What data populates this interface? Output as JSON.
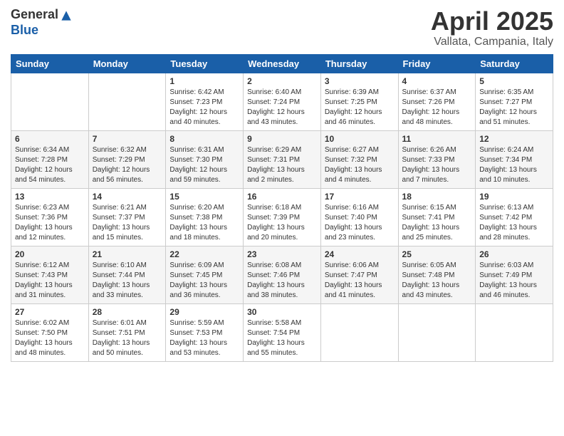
{
  "logo": {
    "text_general": "General",
    "text_blue": "Blue"
  },
  "header": {
    "month_title": "April 2025",
    "location": "Vallata, Campania, Italy"
  },
  "weekdays": [
    "Sunday",
    "Monday",
    "Tuesday",
    "Wednesday",
    "Thursday",
    "Friday",
    "Saturday"
  ],
  "weeks": [
    [
      {
        "day": null
      },
      {
        "day": null
      },
      {
        "day": "1",
        "sunrise": "Sunrise: 6:42 AM",
        "sunset": "Sunset: 7:23 PM",
        "daylight": "Daylight: 12 hours and 40 minutes."
      },
      {
        "day": "2",
        "sunrise": "Sunrise: 6:40 AM",
        "sunset": "Sunset: 7:24 PM",
        "daylight": "Daylight: 12 hours and 43 minutes."
      },
      {
        "day": "3",
        "sunrise": "Sunrise: 6:39 AM",
        "sunset": "Sunset: 7:25 PM",
        "daylight": "Daylight: 12 hours and 46 minutes."
      },
      {
        "day": "4",
        "sunrise": "Sunrise: 6:37 AM",
        "sunset": "Sunset: 7:26 PM",
        "daylight": "Daylight: 12 hours and 48 minutes."
      },
      {
        "day": "5",
        "sunrise": "Sunrise: 6:35 AM",
        "sunset": "Sunset: 7:27 PM",
        "daylight": "Daylight: 12 hours and 51 minutes."
      }
    ],
    [
      {
        "day": "6",
        "sunrise": "Sunrise: 6:34 AM",
        "sunset": "Sunset: 7:28 PM",
        "daylight": "Daylight: 12 hours and 54 minutes."
      },
      {
        "day": "7",
        "sunrise": "Sunrise: 6:32 AM",
        "sunset": "Sunset: 7:29 PM",
        "daylight": "Daylight: 12 hours and 56 minutes."
      },
      {
        "day": "8",
        "sunrise": "Sunrise: 6:31 AM",
        "sunset": "Sunset: 7:30 PM",
        "daylight": "Daylight: 12 hours and 59 minutes."
      },
      {
        "day": "9",
        "sunrise": "Sunrise: 6:29 AM",
        "sunset": "Sunset: 7:31 PM",
        "daylight": "Daylight: 13 hours and 2 minutes."
      },
      {
        "day": "10",
        "sunrise": "Sunrise: 6:27 AM",
        "sunset": "Sunset: 7:32 PM",
        "daylight": "Daylight: 13 hours and 4 minutes."
      },
      {
        "day": "11",
        "sunrise": "Sunrise: 6:26 AM",
        "sunset": "Sunset: 7:33 PM",
        "daylight": "Daylight: 13 hours and 7 minutes."
      },
      {
        "day": "12",
        "sunrise": "Sunrise: 6:24 AM",
        "sunset": "Sunset: 7:34 PM",
        "daylight": "Daylight: 13 hours and 10 minutes."
      }
    ],
    [
      {
        "day": "13",
        "sunrise": "Sunrise: 6:23 AM",
        "sunset": "Sunset: 7:36 PM",
        "daylight": "Daylight: 13 hours and 12 minutes."
      },
      {
        "day": "14",
        "sunrise": "Sunrise: 6:21 AM",
        "sunset": "Sunset: 7:37 PM",
        "daylight": "Daylight: 13 hours and 15 minutes."
      },
      {
        "day": "15",
        "sunrise": "Sunrise: 6:20 AM",
        "sunset": "Sunset: 7:38 PM",
        "daylight": "Daylight: 13 hours and 18 minutes."
      },
      {
        "day": "16",
        "sunrise": "Sunrise: 6:18 AM",
        "sunset": "Sunset: 7:39 PM",
        "daylight": "Daylight: 13 hours and 20 minutes."
      },
      {
        "day": "17",
        "sunrise": "Sunrise: 6:16 AM",
        "sunset": "Sunset: 7:40 PM",
        "daylight": "Daylight: 13 hours and 23 minutes."
      },
      {
        "day": "18",
        "sunrise": "Sunrise: 6:15 AM",
        "sunset": "Sunset: 7:41 PM",
        "daylight": "Daylight: 13 hours and 25 minutes."
      },
      {
        "day": "19",
        "sunrise": "Sunrise: 6:13 AM",
        "sunset": "Sunset: 7:42 PM",
        "daylight": "Daylight: 13 hours and 28 minutes."
      }
    ],
    [
      {
        "day": "20",
        "sunrise": "Sunrise: 6:12 AM",
        "sunset": "Sunset: 7:43 PM",
        "daylight": "Daylight: 13 hours and 31 minutes."
      },
      {
        "day": "21",
        "sunrise": "Sunrise: 6:10 AM",
        "sunset": "Sunset: 7:44 PM",
        "daylight": "Daylight: 13 hours and 33 minutes."
      },
      {
        "day": "22",
        "sunrise": "Sunrise: 6:09 AM",
        "sunset": "Sunset: 7:45 PM",
        "daylight": "Daylight: 13 hours and 36 minutes."
      },
      {
        "day": "23",
        "sunrise": "Sunrise: 6:08 AM",
        "sunset": "Sunset: 7:46 PM",
        "daylight": "Daylight: 13 hours and 38 minutes."
      },
      {
        "day": "24",
        "sunrise": "Sunrise: 6:06 AM",
        "sunset": "Sunset: 7:47 PM",
        "daylight": "Daylight: 13 hours and 41 minutes."
      },
      {
        "day": "25",
        "sunrise": "Sunrise: 6:05 AM",
        "sunset": "Sunset: 7:48 PM",
        "daylight": "Daylight: 13 hours and 43 minutes."
      },
      {
        "day": "26",
        "sunrise": "Sunrise: 6:03 AM",
        "sunset": "Sunset: 7:49 PM",
        "daylight": "Daylight: 13 hours and 46 minutes."
      }
    ],
    [
      {
        "day": "27",
        "sunrise": "Sunrise: 6:02 AM",
        "sunset": "Sunset: 7:50 PM",
        "daylight": "Daylight: 13 hours and 48 minutes."
      },
      {
        "day": "28",
        "sunrise": "Sunrise: 6:01 AM",
        "sunset": "Sunset: 7:51 PM",
        "daylight": "Daylight: 13 hours and 50 minutes."
      },
      {
        "day": "29",
        "sunrise": "Sunrise: 5:59 AM",
        "sunset": "Sunset: 7:53 PM",
        "daylight": "Daylight: 13 hours and 53 minutes."
      },
      {
        "day": "30",
        "sunrise": "Sunrise: 5:58 AM",
        "sunset": "Sunset: 7:54 PM",
        "daylight": "Daylight: 13 hours and 55 minutes."
      },
      {
        "day": null
      },
      {
        "day": null
      },
      {
        "day": null
      }
    ]
  ]
}
